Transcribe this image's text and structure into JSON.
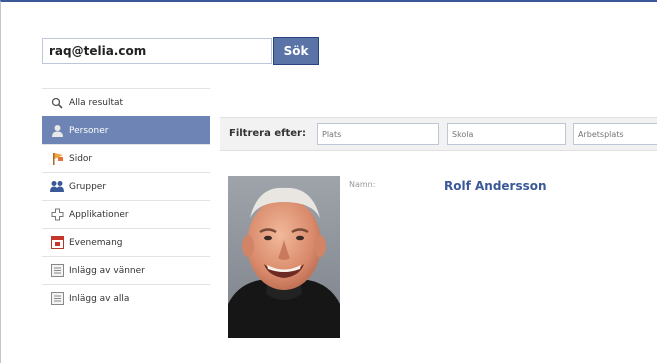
{
  "search": {
    "query": "raq@telia.com",
    "button_label": "Sök"
  },
  "sidebar": {
    "items": [
      {
        "label": "Alla resultat",
        "icon": "magnifier-icon"
      },
      {
        "label": "Personer",
        "icon": "person-icon",
        "active": true
      },
      {
        "label": "Sidor",
        "icon": "flag-icon"
      },
      {
        "label": "Grupper",
        "icon": "group-icon"
      },
      {
        "label": "Applikationer",
        "icon": "puzzle-icon"
      },
      {
        "label": "Evenemang",
        "icon": "calendar-icon"
      },
      {
        "label": "Inlägg av vänner",
        "icon": "posts-icon"
      },
      {
        "label": "Inlägg av alla",
        "icon": "posts-icon"
      }
    ]
  },
  "filter": {
    "label": "Filtrera efter:",
    "fields": [
      {
        "placeholder": "Plats"
      },
      {
        "placeholder": "Skola"
      },
      {
        "placeholder": "Arbetsplats"
      }
    ]
  },
  "result": {
    "name_label": "Namn:",
    "name": "Rolf Andersson"
  },
  "colors": {
    "brand": "#3b5998",
    "active_bg": "#6d84b4",
    "button_bg": "#5b74a8"
  }
}
